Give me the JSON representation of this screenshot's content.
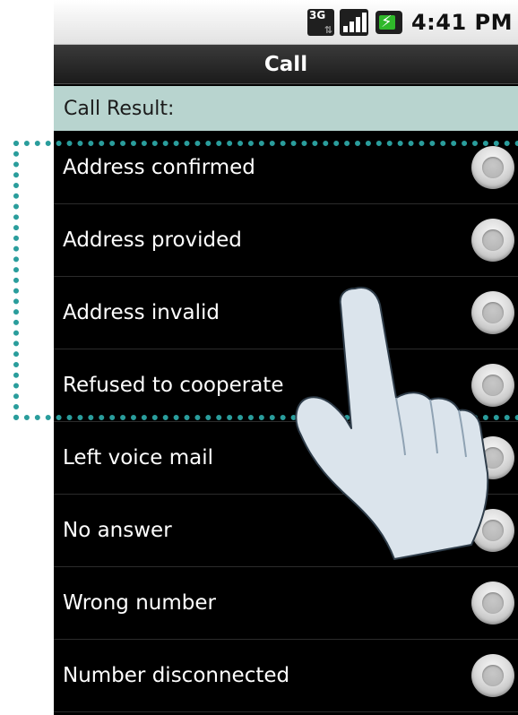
{
  "status_bar": {
    "network_type": "3G",
    "time": "4:41 PM"
  },
  "title_bar": {
    "title": "Call"
  },
  "section": {
    "header": "Call Result:"
  },
  "options": [
    {
      "label": "Address confirmed"
    },
    {
      "label": "Address provided"
    },
    {
      "label": "Address invalid"
    },
    {
      "label": "Refused to cooperate"
    },
    {
      "label": "Left voice mail"
    },
    {
      "label": "No answer"
    },
    {
      "label": "Wrong number"
    },
    {
      "label": "Number disconnected"
    }
  ],
  "icons": {
    "network": "3g-icon",
    "signal": "signal-icon",
    "battery": "battery-charging-icon",
    "radio": "radio-button-icon",
    "pointer": "pointing-hand-icon"
  },
  "colors": {
    "section_header_bg": "#b8d4cf",
    "highlight_border": "#2a9d9c",
    "list_bg": "#000000",
    "title_bar_bg": "#2b2b2b"
  }
}
